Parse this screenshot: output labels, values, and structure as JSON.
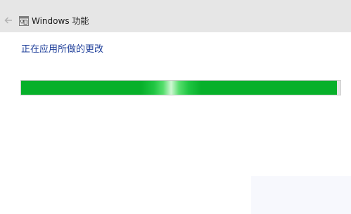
{
  "window": {
    "title": "Windows 功能",
    "icons": {
      "back": "arrow-left-icon",
      "app": "windows-features-icon"
    }
  },
  "main": {
    "status_text": "正在应用所做的更改",
    "progress": 0.99
  },
  "colors": {
    "titlebar_bg": "#e6e6e6",
    "status_text": "#1f3f9a",
    "progress_green": "#07b02a",
    "track_bg": "#e6e6e6"
  }
}
